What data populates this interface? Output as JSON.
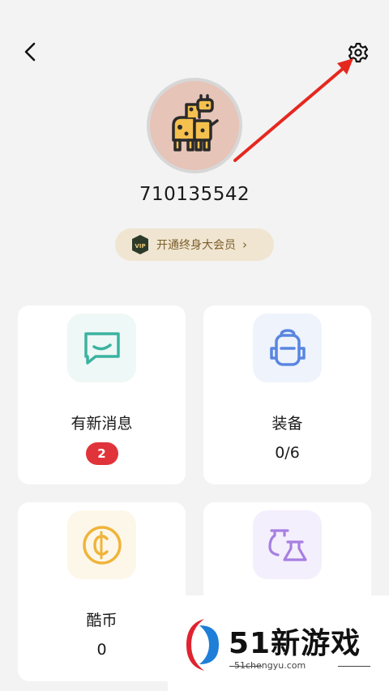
{
  "header": {
    "back_icon": "chevron-left-icon",
    "settings_icon": "gear-icon"
  },
  "profile": {
    "avatar_icon": "giraffe-icon",
    "user_id": "710135542",
    "vip_label": "开通终身大会员",
    "vip_chevron": "›",
    "vip_badge_text": "VIP"
  },
  "cards": [
    {
      "title": "有新消息",
      "value": "2",
      "icon": "message-icon",
      "icon_color": "#3bb3a0",
      "icon_bg": "#eef8f6"
    },
    {
      "title": "装备",
      "value": "0/6",
      "icon": "backpack-icon",
      "icon_color": "#5a86e0",
      "icon_bg": "#eef3fc"
    },
    {
      "title": "酷币",
      "value": "0",
      "icon": "coin-icon",
      "icon_color": "#f0b43a",
      "icon_bg": "#fdf7ea"
    },
    {
      "title": "",
      "value": "",
      "icon": "flask-icon",
      "icon_color": "#a77fe2",
      "icon_bg": "#f4effc"
    }
  ],
  "watermark": {
    "brand": "51新游戏",
    "url": "51chengyu.com"
  },
  "colors": {
    "background": "#f3f3f3",
    "annotation_arrow": "#e5281f",
    "badge_red": "#e0343a"
  }
}
